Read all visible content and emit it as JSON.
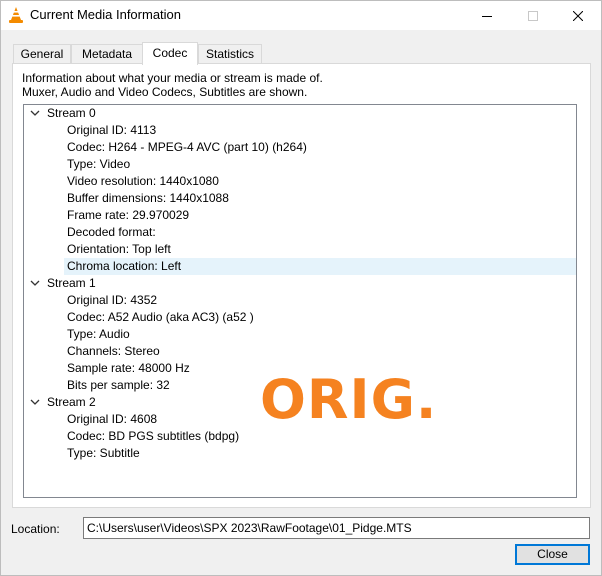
{
  "window": {
    "title": "Current Media Information"
  },
  "tabs": [
    {
      "label": "General"
    },
    {
      "label": "Metadata"
    },
    {
      "label": "Codec",
      "active": true
    },
    {
      "label": "Statistics"
    }
  ],
  "codec_panel": {
    "info_line_1": "Information about what your media or stream is made of.",
    "info_line_2": "Muxer, Audio and Video Codecs, Subtitles are shown.",
    "streams": [
      {
        "label": "Stream 0",
        "items": [
          "Original ID: 4113",
          "Codec: H264 - MPEG-4 AVC (part 10) (h264)",
          "Type: Video",
          "Video resolution: 1440x1080",
          "Buffer dimensions: 1440x1088",
          "Frame rate: 29.970029",
          "Decoded format:",
          "Orientation: Top left",
          "Chroma location: Left"
        ],
        "selected_item": "Chroma location: Left"
      },
      {
        "label": "Stream 1",
        "items": [
          "Original ID: 4352",
          "Codec: A52 Audio (aka AC3) (a52 )",
          "Type: Audio",
          "Channels: Stereo",
          "Sample rate: 48000 Hz",
          "Bits per sample: 32"
        ]
      },
      {
        "label": "Stream 2",
        "items": [
          "Original ID: 4608",
          "Codec: BD PGS subtitles (bdpg)",
          "Type: Subtitle"
        ]
      }
    ]
  },
  "watermark": "ORIG.",
  "location": {
    "label": "Location:",
    "value": "C:\\Users\\user\\Videos\\SPX 2023\\RawFootage\\01_Pidge.MTS"
  },
  "buttons": {
    "close_label": "Close"
  },
  "icons": {
    "app": "vlc-cone-icon",
    "minimize": "minimize-icon",
    "maximize": "maximize-icon",
    "close": "close-icon",
    "expand": "chevron-down-icon"
  },
  "colors": {
    "accent": "#0078d7",
    "selection": "#e5f3fb",
    "watermark": "#f58220"
  }
}
